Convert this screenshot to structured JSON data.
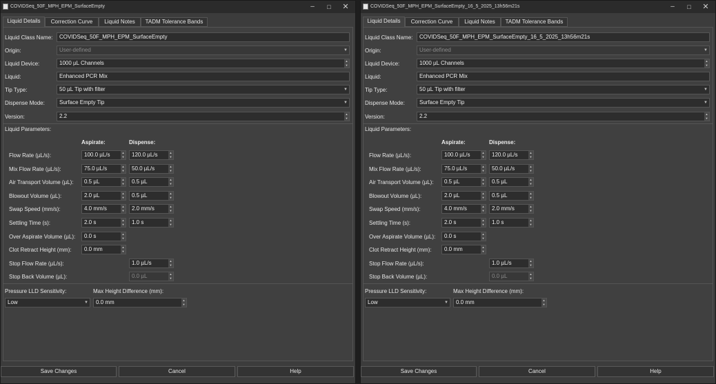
{
  "windows": [
    {
      "title": "COVIDSeq_50F_MPH_EPM_SurfaceEmpty",
      "tabs": [
        "Liquid Details",
        "Correction Curve",
        "Liquid Notes",
        "TADM Tolerance Bands"
      ],
      "fields": {
        "liquid_class_name": {
          "label": "Liquid Class Name:",
          "value": "COVIDSeq_50F_MPH_EPM_SurfaceEmpty"
        },
        "origin": {
          "label": "Origin:",
          "value": "User-defined"
        },
        "liquid_device": {
          "label": "Liquid Device:",
          "value": "1000 µL Channels"
        },
        "liquid": {
          "label": "Liquid:",
          "value": "Enhanced PCR Mix"
        },
        "tip_type": {
          "label": "Tip Type:",
          "value": "50 µL Tip with filter"
        },
        "dispense_mode": {
          "label": "Dispense Mode:",
          "value": "Surface Empty Tip"
        },
        "version": {
          "label": "Version:",
          "value": "2.2"
        }
      },
      "liquid_parameters_label": "Liquid Parameters:",
      "aspirate_header": "Aspirate:",
      "dispense_header": "Dispense:",
      "params": [
        {
          "label": "Flow Rate (µL/s):",
          "aspirate": "100.0  µL/s",
          "dispense": "120.0  µL/s"
        },
        {
          "label": "Mix Flow Rate (µL/s):",
          "aspirate": "75.0  µL/s",
          "dispense": "50.0  µL/s"
        },
        {
          "label": "Air Transport Volume (µL):",
          "aspirate": "0.5  µL",
          "dispense": "0.5  µL"
        },
        {
          "label": "Blowout Volume (µL):",
          "aspirate": "2.0  µL",
          "dispense": "0.5  µL"
        },
        {
          "label": "Swap Speed (mm/s):",
          "aspirate": "4.0  mm/s",
          "dispense": "2.0  mm/s"
        },
        {
          "label": "Settling Time (s):",
          "aspirate": "2.0  s",
          "dispense": "1.0  s"
        },
        {
          "label": "Over Aspirate Volume (µL):",
          "aspirate": "0.0  s",
          "dispense": null
        },
        {
          "label": "Clot Retract Height (mm):",
          "aspirate": "0.0  mm",
          "dispense": null
        },
        {
          "label": "Stop Flow Rate (µL/s):",
          "aspirate": null,
          "dispense": "1.0  µL/s"
        },
        {
          "label": "Stop Back Volume (µL):",
          "aspirate": null,
          "dispense": "0.0  µL"
        }
      ],
      "pressure_lld": {
        "label": "Pressure LLD Sensitivity:",
        "value": "Low"
      },
      "max_height_diff": {
        "label": "Max Height Difference (mm):",
        "value": "0.0  mm"
      },
      "buttons": {
        "save": "Save Changes",
        "cancel": "Cancel",
        "help": "Help"
      }
    },
    {
      "title": "COVIDSeq_50F_MPH_EPM_SurfaceEmpty_16_5_2025_13h56m21s",
      "tabs": [
        "Liquid Details",
        "Correction Curve",
        "Liquid Notes",
        "TADM Tolerance Bands"
      ],
      "fields": {
        "liquid_class_name": {
          "label": "Liquid Class Name:",
          "value": "COVIDSeq_50F_MPH_EPM_SurfaceEmpty_16_5_2025_13h56m21s"
        },
        "origin": {
          "label": "Origin:",
          "value": "User-defined"
        },
        "liquid_device": {
          "label": "Liquid Device:",
          "value": "1000 µL Channels"
        },
        "liquid": {
          "label": "Liquid:",
          "value": "Enhanced PCR Mix"
        },
        "tip_type": {
          "label": "Tip Type:",
          "value": "50 µL Tip with filter"
        },
        "dispense_mode": {
          "label": "Dispense Mode:",
          "value": "Surface Empty Tip"
        },
        "version": {
          "label": "Version:",
          "value": "2.2"
        }
      },
      "liquid_parameters_label": "Liquid Parameters:",
      "aspirate_header": "Aspirate:",
      "dispense_header": "Dispense:",
      "params": [
        {
          "label": "Flow Rate (µL/s):",
          "aspirate": "100.0  µL/s",
          "dispense": "120.0  µL/s"
        },
        {
          "label": "Mix Flow Rate (µL/s):",
          "aspirate": "75.0  µL/s",
          "dispense": "50.0  µL/s"
        },
        {
          "label": "Air Transport Volume (µL):",
          "aspirate": "0.5  µL",
          "dispense": "0.5  µL"
        },
        {
          "label": "Blowout Volume (µL):",
          "aspirate": "2.0  µL",
          "dispense": "0.5  µL"
        },
        {
          "label": "Swap Speed (mm/s):",
          "aspirate": "4.0  mm/s",
          "dispense": "2.0  mm/s"
        },
        {
          "label": "Settling Time (s):",
          "aspirate": "2.0  s",
          "dispense": "1.0  s"
        },
        {
          "label": "Over Aspirate Volume (µL):",
          "aspirate": "0.0  s",
          "dispense": null
        },
        {
          "label": "Clot Retract Height (mm):",
          "aspirate": "0.0  mm",
          "dispense": null
        },
        {
          "label": "Stop Flow Rate (µL/s):",
          "aspirate": null,
          "dispense": "1.0  µL/s"
        },
        {
          "label": "Stop Back Volume (µL):",
          "aspirate": null,
          "dispense": "0.0  µL"
        }
      ],
      "pressure_lld": {
        "label": "Pressure LLD Sensitivity:",
        "value": "Low"
      },
      "max_height_diff": {
        "label": "Max Height Difference (mm):",
        "value": "0.0  mm"
      },
      "buttons": {
        "save": "Save Changes",
        "cancel": "Cancel",
        "help": "Help"
      }
    }
  ]
}
